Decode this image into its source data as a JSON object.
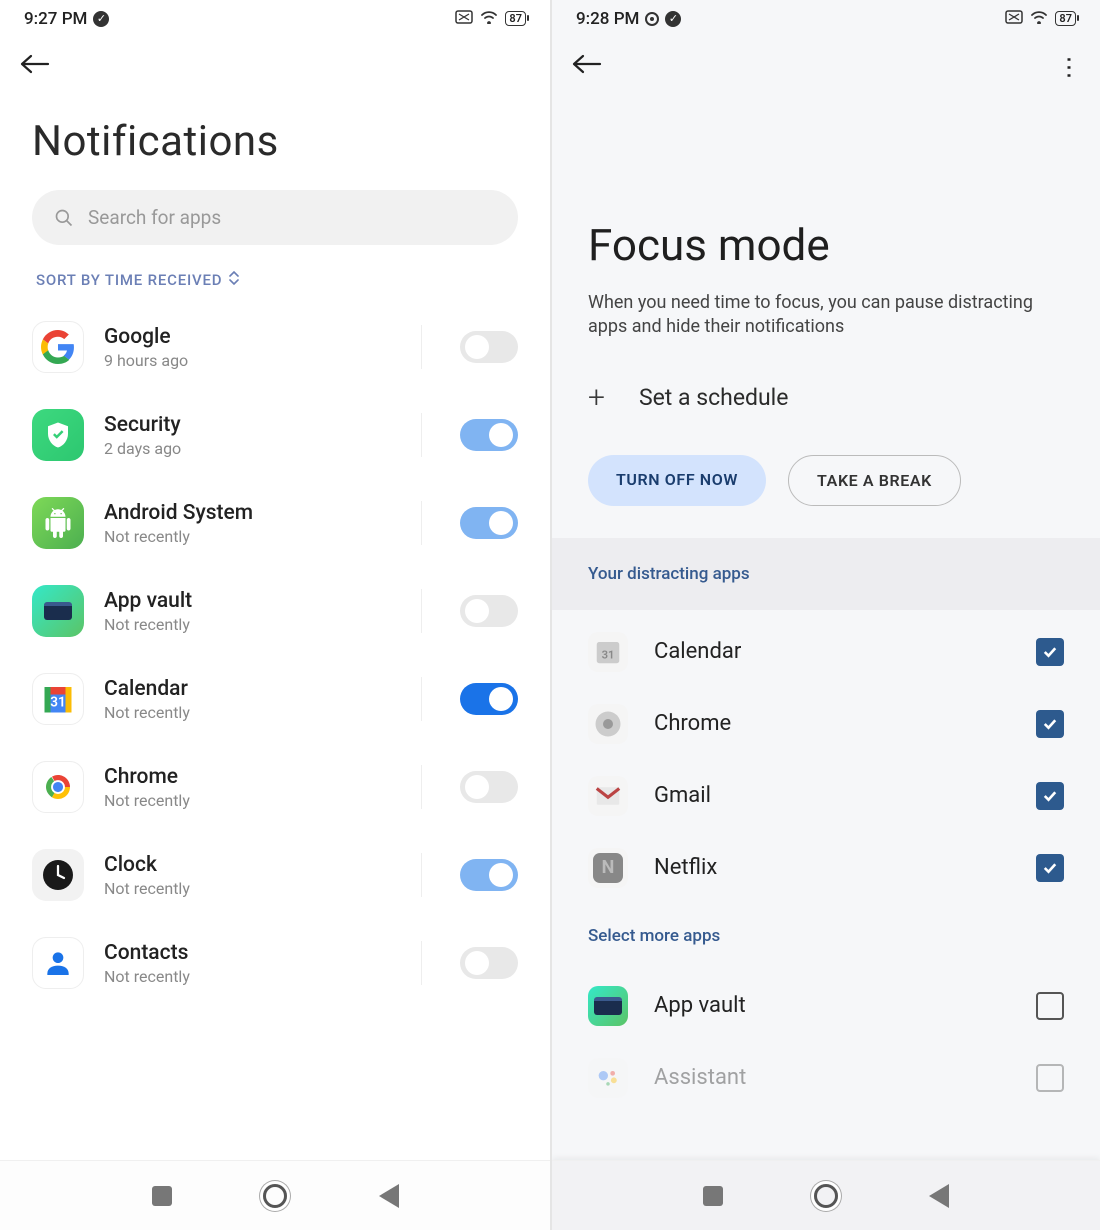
{
  "left": {
    "status": {
      "time": "9:27 PM",
      "battery": "87"
    },
    "title": "Notifications",
    "search_placeholder": "Search for apps",
    "sort_label": "SORT BY TIME RECEIVED",
    "apps": [
      {
        "name": "Google",
        "sub": "9 hours ago",
        "toggle": "off",
        "icon": "google"
      },
      {
        "name": "Security",
        "sub": "2 days ago",
        "toggle": "on-light",
        "icon": "security"
      },
      {
        "name": "Android System",
        "sub": "Not recently",
        "toggle": "on-light",
        "icon": "android"
      },
      {
        "name": "App vault",
        "sub": "Not recently",
        "toggle": "off",
        "icon": "appvault"
      },
      {
        "name": "Calendar",
        "sub": "Not recently",
        "toggle": "on-dark",
        "icon": "calendar"
      },
      {
        "name": "Chrome",
        "sub": "Not recently",
        "toggle": "off",
        "icon": "chrome"
      },
      {
        "name": "Clock",
        "sub": "Not recently",
        "toggle": "on-light",
        "icon": "clock"
      },
      {
        "name": "Contacts",
        "sub": "Not recently",
        "toggle": "off",
        "icon": "contacts"
      }
    ]
  },
  "right": {
    "status": {
      "time": "9:28 PM",
      "battery": "87"
    },
    "title": "Focus mode",
    "desc": "When you need time to focus, you can pause distracting apps and hide their notifications",
    "schedule_label": "Set a schedule",
    "btn_primary": "TURN OFF NOW",
    "btn_secondary": "TAKE A BREAK",
    "section_distracting": "Your distracting apps",
    "section_more": "Select more apps",
    "distracting": [
      {
        "name": "Calendar",
        "checked": true,
        "icon": "calendar-g"
      },
      {
        "name": "Chrome",
        "checked": true,
        "icon": "chrome-g"
      },
      {
        "name": "Gmail",
        "checked": true,
        "icon": "gmail-g"
      },
      {
        "name": "Netflix",
        "checked": true,
        "icon": "netflix-g"
      }
    ],
    "more": [
      {
        "name": "App vault",
        "checked": false,
        "icon": "appvault"
      },
      {
        "name": "Assistant",
        "checked": false,
        "icon": "assistant",
        "fade": true
      }
    ]
  }
}
